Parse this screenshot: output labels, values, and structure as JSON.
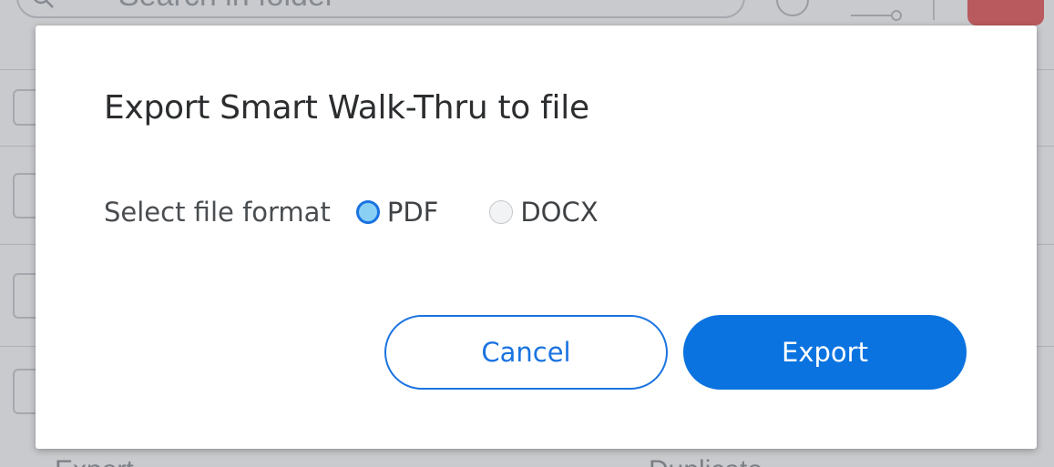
{
  "background": {
    "search_placeholder": "Search in folder",
    "footer_text": "Duplicate",
    "footer_text_left": "Export"
  },
  "dialog": {
    "title": "Export Smart Walk-Thru to file",
    "format_label": "Select file format",
    "options": [
      {
        "label": "PDF",
        "selected": true
      },
      {
        "label": "DOCX",
        "selected": false
      }
    ],
    "cancel_label": "Cancel",
    "export_label": "Export"
  },
  "colors": {
    "primary": "#0a73e0",
    "radio_selected_fill": "#8ad0f5",
    "danger": "#e8585a"
  },
  "icons": {
    "search": "search-icon",
    "clock": "clock-icon",
    "toggle": "toggle-icon"
  }
}
